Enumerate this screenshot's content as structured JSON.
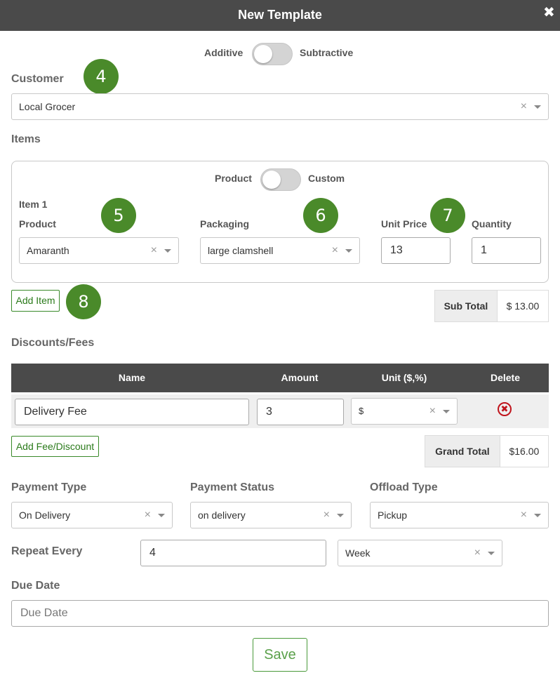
{
  "window": {
    "title": "New Template",
    "close_glyph": "✖"
  },
  "mode_toggle": {
    "left_label": "Additive",
    "right_label": "Subtractive"
  },
  "customer": {
    "label": "Customer",
    "value": "Local Grocer",
    "badge": "4"
  },
  "items": {
    "label": "Items",
    "type_toggle": {
      "left_label": "Product",
      "right_label": "Custom"
    },
    "item_title": "Item 1",
    "product": {
      "label": "Product",
      "value": "Amaranth",
      "badge": "5"
    },
    "packaging": {
      "label": "Packaging",
      "value": "large clamshell",
      "badge": "6"
    },
    "unit_price": {
      "label": "Unit Price",
      "value": "13",
      "badge": "7"
    },
    "quantity": {
      "label": "Quantity",
      "value": "1"
    },
    "add_item": {
      "label": "Add Item",
      "badge": "8"
    },
    "sub_total": {
      "label": "Sub Total",
      "value": "$ 13.00"
    }
  },
  "fees": {
    "label": "Discounts/Fees",
    "headers": {
      "name": "Name",
      "amount": "Amount",
      "unit": "Unit ($,%)",
      "delete": "Delete"
    },
    "rows": [
      {
        "name": "Delivery Fee",
        "amount": "3",
        "unit": "$"
      }
    ],
    "add_label": "Add Fee/Discount",
    "grand_total": {
      "label": "Grand Total",
      "value": "$16.00"
    }
  },
  "payment_type": {
    "label": "Payment Type",
    "value": "On Delivery"
  },
  "payment_status": {
    "label": "Payment Status",
    "value": "on delivery"
  },
  "offload_type": {
    "label": "Offload Type",
    "value": "Pickup"
  },
  "repeat": {
    "label": "Repeat Every",
    "value": "4",
    "unit": "Week"
  },
  "due_date": {
    "label": "Due Date",
    "placeholder": "Due Date"
  },
  "save_label": "Save",
  "glyphs": {
    "clear": "×",
    "delete": "✖"
  },
  "colors": {
    "header_bg": "#4a4a4a",
    "accent_green": "#4a8a2a",
    "delete_red": "#c0141c"
  }
}
